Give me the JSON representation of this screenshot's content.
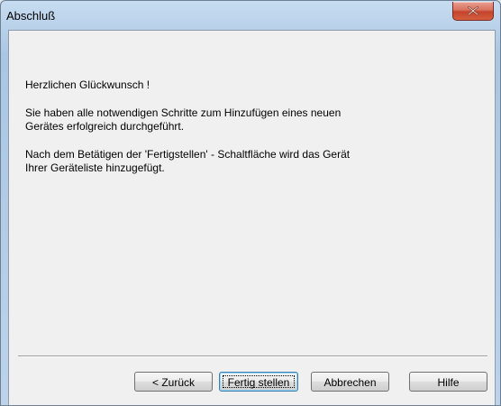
{
  "window": {
    "title": "Abschluß"
  },
  "content": {
    "line1": "Herzlichen Glückwunsch !",
    "line2": "Sie haben alle notwendigen Schritte zum Hinzufügen eines neuen\nGerätes erfolgreich durchgeführt.",
    "line3": "Nach dem Betätigen der 'Fertigstellen' - Schaltfläche wird das Gerät\nIhrer Geräteliste hinzugefügt."
  },
  "buttons": {
    "back": "< Zurück",
    "finish": "Fertig stellen",
    "cancel": "Abbrechen",
    "help": "Hilfe"
  },
  "icons": {
    "close": "close-icon"
  },
  "colors": {
    "close_button": "#c4442c",
    "title_bar": "#b9d1ea",
    "client_background": "#f0f0f0"
  }
}
